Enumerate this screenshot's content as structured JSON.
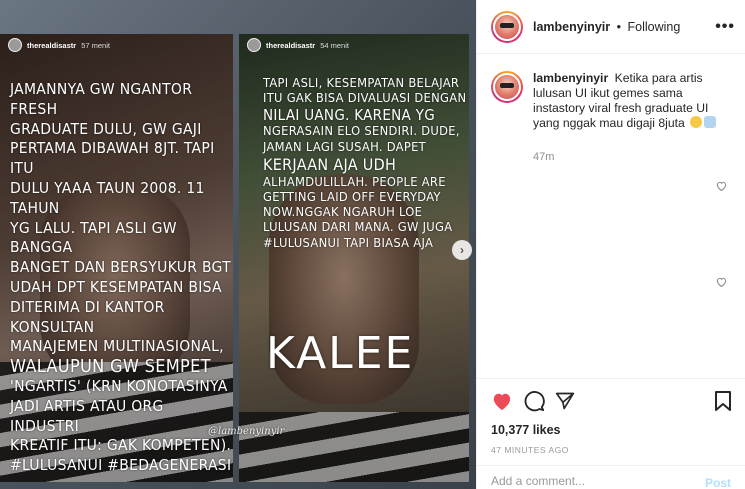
{
  "stories": {
    "left": {
      "username": "therealdisastr",
      "time": "57 menit",
      "lines": [
        "JAMANNYA GW NGANTOR FRESH",
        "GRADUATE DULU, GW GAJI",
        "PERTAMA DIBAWAH 8JT. TAPI ITU",
        "DULU YAAA TAUN 2008. 11 TAHUN",
        "YG LALU. TAPI ASLI GW BANGGA",
        "BANGET DAN BERSYUKUR BGT",
        "UDAH DPT KESEMPATAN BISA",
        "DITERIMA DI KANTOR KONSULTAN",
        "MANAJEMEN MULTINASIONAL,",
        "WALAUPUN GW SEMPET",
        "'NGARTIS' (KRN KONOTASINYA",
        "JADI ARTIS ATAU ORG INDUSTRI",
        "KREATIF ITU: GAK KOMPETEN).",
        "#LULUSANUI #BEDAGENERASI"
      ]
    },
    "right": {
      "username": "therealdisastr",
      "time": "54 menit",
      "lines": [
        "TAPI ASLI, KESEMPATAN BELAJAR",
        "ITU GAK BISA DIVALUASI DENGAN",
        "NILAI UANG. KARENA YG",
        "NGERASAIN ELO SENDIRI. DUDE,",
        "JAMAN LAGI SUSAH. DAPET",
        "KERJAAN AJA UDH",
        "ALHAMDULILLAH. PEOPLE ARE",
        "GETTING LAID OFF EVERYDAY",
        "NOW.NGGAK NGARUH LOE",
        "LULUSAN DARI MANA. GW JUGA",
        "#LULUSANUI TAPI BIASA AJA"
      ],
      "big_word": "KALEE"
    },
    "watermark": "@lambenyinyir"
  },
  "header": {
    "username": "lambenyinyir",
    "separator": "•",
    "follow_status": "Following",
    "more_label": "•••"
  },
  "caption": {
    "username": "lambenyinyir",
    "text": "Ketika para artis lulusan UI ikut gemes sama instastory viral fresh graduate UI yang nggak mau digaji 8juta",
    "time": "47m"
  },
  "actions": {
    "likes": "10,377 likes",
    "time_ago": "47 MINUTES AGO"
  },
  "add_comment": {
    "placeholder": "Add a comment...",
    "post_label": "Post"
  },
  "colors": {
    "link_disabled": "#b2dffc",
    "text": "#262626",
    "muted": "#8e8e8e",
    "heart": "#ed4956"
  }
}
